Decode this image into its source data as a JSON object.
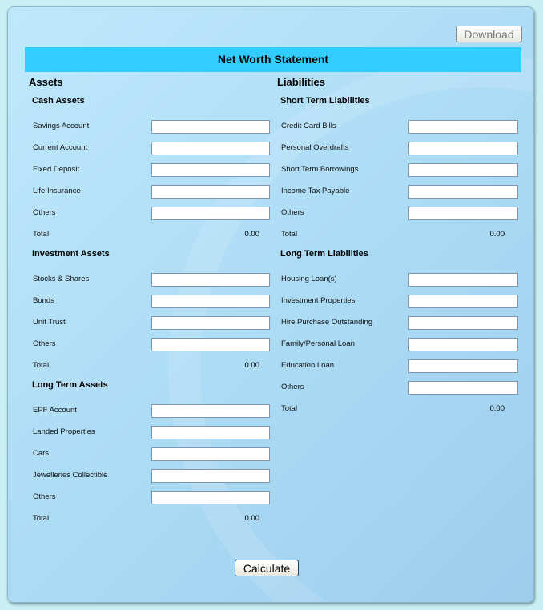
{
  "download_label": "Download",
  "title": "Net Worth Statement",
  "calculate_label": "Calculate",
  "assets": {
    "heading": "Assets",
    "sections": [
      {
        "title": "Cash Assets",
        "items": [
          "Savings Account",
          "Current Account",
          "Fixed Deposit",
          "Life Insurance",
          "Others"
        ],
        "total_label": "Total",
        "total": "0.00"
      },
      {
        "title": "Investment Assets",
        "items": [
          "Stocks & Shares",
          "Bonds",
          "Unit Trust",
          "Others"
        ],
        "total_label": "Total",
        "total": "0.00"
      },
      {
        "title": "Long Term Assets",
        "items": [
          "EPF Account",
          "Landed Properties",
          "Cars",
          "Jewelleries Collectible",
          "Others"
        ],
        "total_label": "Total",
        "total": "0.00"
      }
    ]
  },
  "liabilities": {
    "heading": "Liabilities",
    "sections": [
      {
        "title": "Short Term Liabilities",
        "items": [
          "Credit Card Bills",
          "Personal Overdrafts",
          "Short Term Borrowings",
          "Income Tax Payable",
          "Others"
        ],
        "total_label": "Total",
        "total": "0.00"
      },
      {
        "title": "Long Term Liabilities",
        "items": [
          "Housing Loan(s)",
          "Investment Properties",
          "Hire Purchase Outstanding",
          "Family/Personal Loan",
          "Education Loan",
          "Others"
        ],
        "total_label": "Total",
        "total": "0.00"
      }
    ]
  }
}
